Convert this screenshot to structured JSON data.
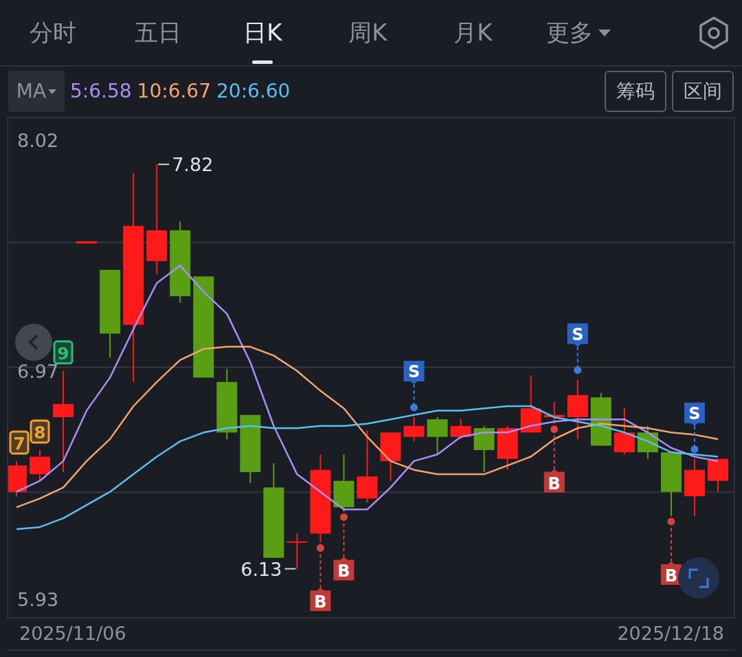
{
  "tabs": [
    {
      "label": "分时",
      "selected": false
    },
    {
      "label": "五日",
      "selected": false
    },
    {
      "label": "日K",
      "selected": true
    },
    {
      "label": "周K",
      "selected": false
    },
    {
      "label": "月K",
      "selected": false
    },
    {
      "label": "更多",
      "selected": false,
      "has_menu": true
    }
  ],
  "indicator": {
    "label": "MA"
  },
  "ma_legend": [
    {
      "text": "5:6.58",
      "color": "#a98ff5"
    },
    {
      "text": "10:6.67",
      "color": "#f5a46a"
    },
    {
      "text": "20:6.60",
      "color": "#58c0f0"
    }
  ],
  "tool_buttons": [
    "筹码",
    "区间"
  ],
  "chart": {
    "chart_data": {
      "type": "line",
      "ylim": [
        5.84,
        8.11
      ],
      "yticks": [
        8.02,
        6.97,
        5.93
      ],
      "series": [
        {
          "color": "#a98ff5",
          "values": [
            6.41,
            6.46,
            6.55,
            6.78,
            6.93,
            7.15,
            7.36,
            7.44,
            7.32,
            7.22,
            7.0,
            6.71,
            6.49,
            6.41,
            6.33,
            6.33,
            6.43,
            6.55,
            6.58,
            6.66,
            6.68,
            6.68,
            6.71,
            6.73,
            6.74,
            6.74,
            6.74,
            6.68,
            6.61,
            6.57,
            6.55
          ]
        },
        {
          "color": "#f5a46a",
          "values": [
            6.34,
            6.38,
            6.43,
            6.55,
            6.65,
            6.8,
            6.91,
            7.01,
            7.06,
            7.07,
            7.07,
            7.03,
            6.96,
            6.87,
            6.79,
            6.66,
            6.55,
            6.51,
            6.49,
            6.49,
            6.49,
            6.53,
            6.57,
            6.65,
            6.7,
            6.72,
            6.71,
            6.7,
            6.68,
            6.67,
            6.65
          ]
        },
        {
          "color": "#58c0f0",
          "values": [
            6.24,
            6.25,
            6.29,
            6.35,
            6.41,
            6.49,
            6.57,
            6.64,
            6.68,
            6.7,
            6.71,
            6.7,
            6.7,
            6.71,
            6.71,
            6.72,
            6.74,
            6.76,
            6.78,
            6.78,
            6.79,
            6.8,
            6.8,
            6.75,
            6.73,
            6.71,
            6.68,
            6.64,
            6.59,
            6.58,
            6.57
          ]
        }
      ]
    },
    "candles": [
      {
        "rising": true,
        "count": "7",
        "color": "#f0a030"
      },
      {
        "rising": true,
        "count": "8",
        "color": "#f0a030"
      },
      {
        "rising": true,
        "count": "9",
        "color": "#28c070"
      },
      {
        "rising": true
      },
      {
        "rising": false
      },
      {
        "rising": true
      },
      {
        "rising": true,
        "high_label": "7.82"
      },
      {
        "rising": false
      },
      {
        "rising": false
      },
      {
        "rising": false
      },
      {
        "rising": false
      },
      {
        "rising": false
      },
      {
        "rising": true,
        "low_label": "6.13"
      },
      {
        "rising": true,
        "signal": "B"
      },
      {
        "rising": false,
        "signal": "B"
      },
      {
        "rising": true
      },
      {
        "rising": true
      },
      {
        "rising": true,
        "signal": "S"
      },
      {
        "rising": false
      },
      {
        "rising": true
      },
      {
        "rising": false
      },
      {
        "rising": true
      },
      {
        "rising": true
      },
      {
        "rising": true,
        "signal": "B"
      },
      {
        "rising": true,
        "signal": "S"
      },
      {
        "rising": false
      },
      {
        "rising": true
      },
      {
        "rising": false
      },
      {
        "rising": false,
        "signal": "B"
      },
      {
        "rising": true,
        "signal": "S"
      },
      {
        "rising": true
      }
    ],
    "date_labels": [
      "2025/11/06",
      "2025/12/18"
    ]
  }
}
